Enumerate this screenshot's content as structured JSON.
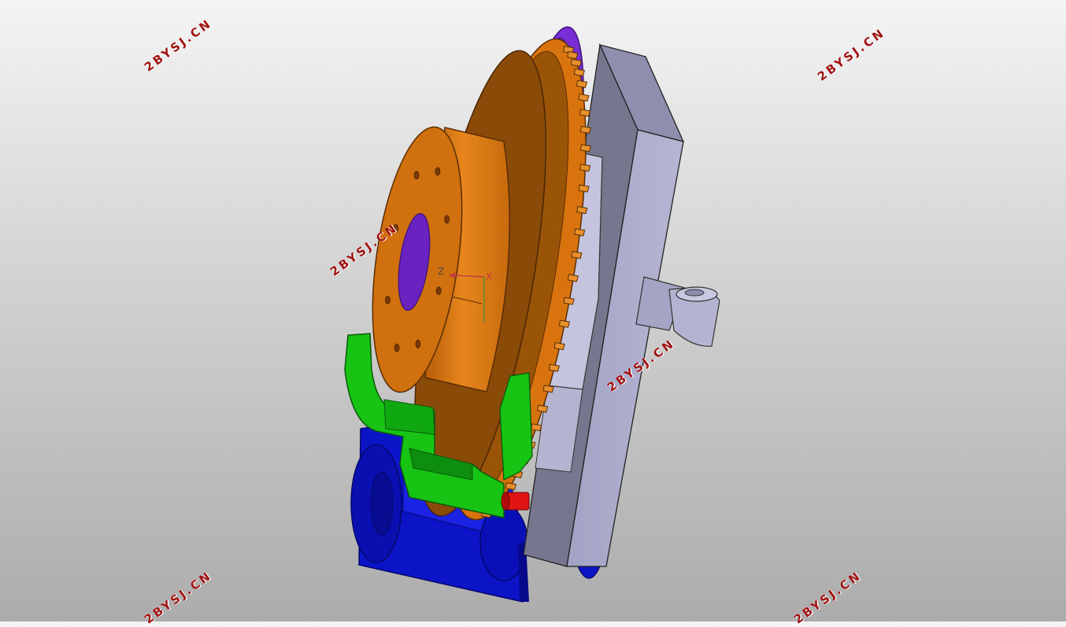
{
  "watermark": {
    "text": "2BYSJ.CN",
    "color": "#a01212"
  },
  "axis_triad": {
    "z_label": "Z",
    "x_label": "X"
  },
  "colors": {
    "background_top": "#f4f4f4",
    "background_bottom": "#acacac",
    "rotor_orange": "#d8730e",
    "rotor_dark": "#8a4a08",
    "disc_purple": "#7a2ed6",
    "mount_lavender": "#a4a4c6",
    "caliper_green": "#17c414",
    "base_blue": "#0c14d8",
    "pin_red": "#e01414"
  }
}
